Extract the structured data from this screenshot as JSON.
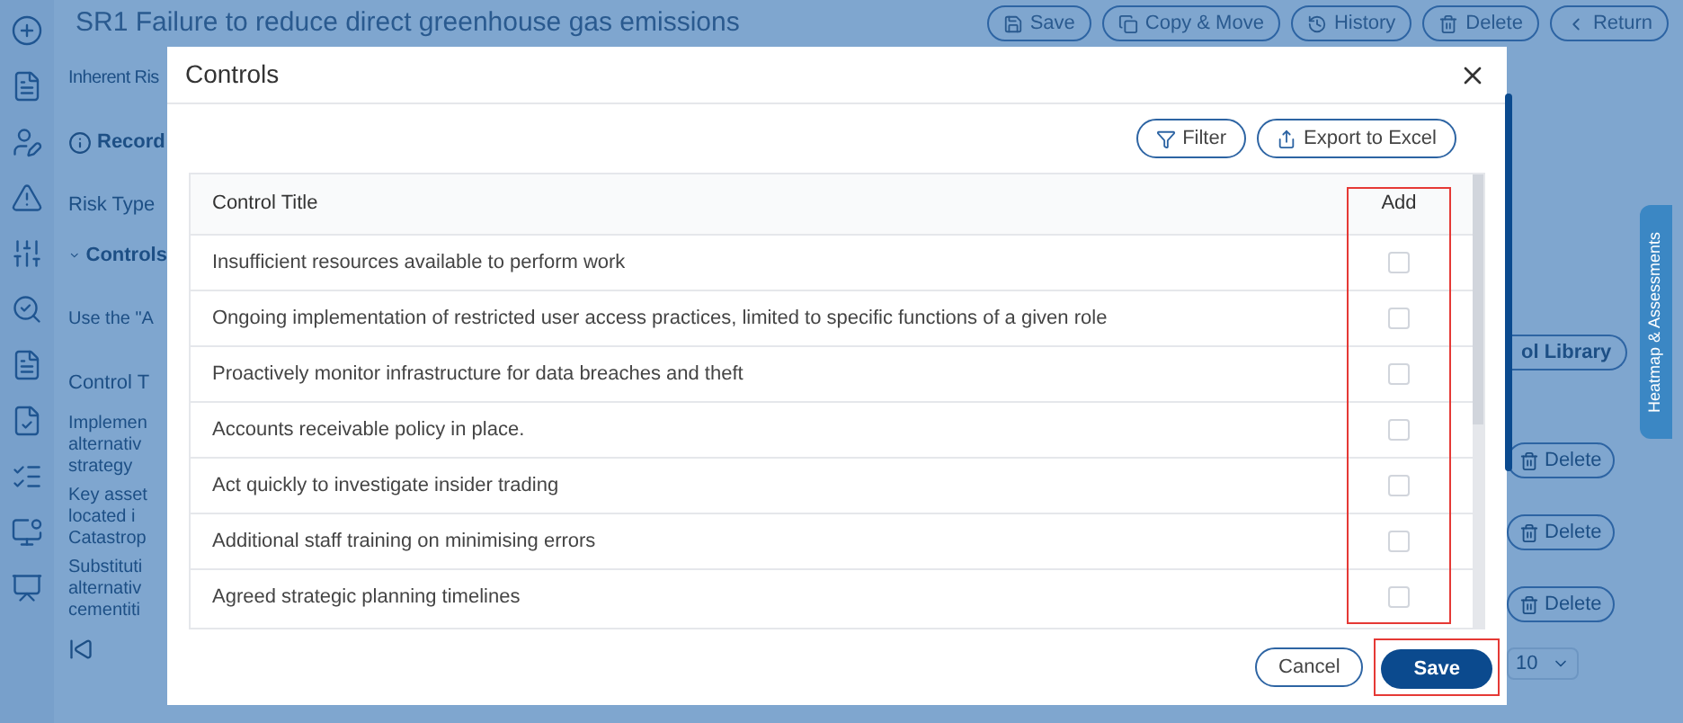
{
  "page": {
    "title": "SR1 Failure to reduce direct greenhouse gas emissions",
    "header_buttons": [
      {
        "label": "Save",
        "kind": "save"
      },
      {
        "label": "Copy & Move",
        "kind": "copy"
      },
      {
        "label": "History",
        "kind": "history"
      },
      {
        "label": "Delete",
        "kind": "delete"
      },
      {
        "label": "Return",
        "kind": "return"
      }
    ],
    "tab": "Inherent Ris",
    "record": "Record",
    "risk_type_label": "Risk Type",
    "section": {
      "label": "Controls",
      "expanded": true
    },
    "hint": "Use the \"A",
    "library_button": "ol Library",
    "table_header": "Control T",
    "rows": [
      {
        "lines": [
          "Implemen",
          "alternativ",
          "strategy"
        ],
        "action": "Delete"
      },
      {
        "lines": [
          "Key asset",
          "located i",
          "Catastrop"
        ],
        "action": "Delete"
      },
      {
        "lines": [
          "Substituti",
          "alternativ",
          "cementiti"
        ],
        "action": "Delete"
      }
    ],
    "page_size": "10",
    "side_tab": "Heatmap & Assessments"
  },
  "dialog": {
    "title": "Controls",
    "toolbar": [
      {
        "label": "Filter",
        "kind": "filter"
      },
      {
        "label": "Export to Excel",
        "kind": "export"
      }
    ],
    "columns": [
      {
        "label": "Control Title"
      },
      {
        "label": "Add",
        "highlighted": true
      }
    ],
    "rows": [
      {
        "title": "Insufficient resources available to perform work",
        "checked": false
      },
      {
        "title": "Ongoing implementation of restricted user access practices, limited to specific functions of a given role",
        "checked": false
      },
      {
        "title": "Proactively monitor infrastructure for data breaches and theft",
        "checked": false
      },
      {
        "title": "Accounts receivable policy in place.",
        "checked": false
      },
      {
        "title": "Act quickly to investigate insider trading",
        "checked": false
      },
      {
        "title": "Additional staff training on minimising errors",
        "checked": false
      },
      {
        "title": "Agreed strategic planning timelines",
        "checked": false
      }
    ],
    "buttons": [
      {
        "label": "Cancel",
        "kind": "secondary",
        "highlighted": false
      },
      {
        "label": "Save",
        "kind": "primary",
        "highlighted": true
      }
    ]
  }
}
